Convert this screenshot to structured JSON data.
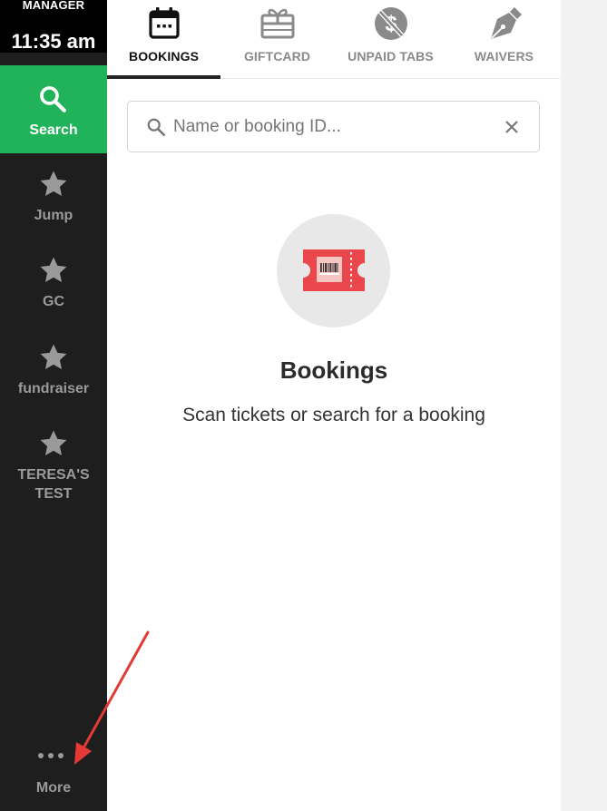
{
  "sidebar": {
    "role": "MANAGER",
    "clock": "11:35 am",
    "search": {
      "label": "Search",
      "icon": "search-icon"
    },
    "items": [
      {
        "label": "Jump",
        "icon": "star-icon"
      },
      {
        "label": "GC",
        "icon": "star-icon"
      },
      {
        "label": "fundraiser",
        "icon": "star-icon"
      },
      {
        "label": "TERESA'S TEST",
        "icon": "star-icon"
      }
    ],
    "more": {
      "label": "More",
      "icon": "more-dots-icon"
    }
  },
  "tabs": [
    {
      "label": "BOOKINGS",
      "icon": "calendar-icon",
      "active": true
    },
    {
      "label": "GIFTCARD",
      "icon": "gift-card-icon",
      "active": false
    },
    {
      "label": "UNPAID TABS",
      "icon": "no-dollar-icon",
      "active": false
    },
    {
      "label": "WAIVERS",
      "icon": "pen-nib-icon",
      "active": false
    }
  ],
  "search": {
    "placeholder": "Name or booking ID...",
    "value": ""
  },
  "empty_state": {
    "icon": "ticket-icon",
    "title": "Bookings",
    "subtitle": "Scan tickets or search for a booking"
  },
  "colors": {
    "sidebar_bg": "#1e1e1e",
    "accent_green": "#21b35a",
    "ticket_red": "#e9474b",
    "annotation_red": "#e53935"
  }
}
